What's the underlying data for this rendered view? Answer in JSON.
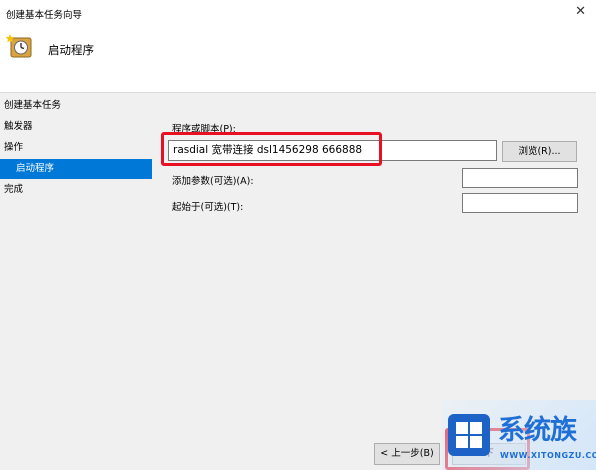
{
  "window": {
    "title": "创建基本任务向导",
    "close_glyph": "✕"
  },
  "header": {
    "title": "启动程序",
    "icon": "task-clock-icon"
  },
  "nav": {
    "items": [
      {
        "label": "创建基本任务",
        "selected": false
      },
      {
        "label": "触发器",
        "selected": false
      },
      {
        "label": "操作",
        "selected": false
      },
      {
        "label": "启动程序",
        "selected": true
      },
      {
        "label": "完成",
        "selected": false
      }
    ]
  },
  "form": {
    "program_label": "程序或脚本(P):",
    "program_value": "rasdial 宽带连接 dsl1456298 666888",
    "browse_label": "浏览(R)...",
    "args_label": "添加参数(可选)(A):",
    "args_value": "",
    "startin_label": "起始于(可选)(T):",
    "startin_value": ""
  },
  "footer": {
    "back_label": "< 上一步(B)",
    "next_label": "下"
  },
  "watermark": {
    "text": "系统族",
    "url": "WWW.XITONGZU.COM"
  },
  "colors": {
    "highlight": "#e81123",
    "selection": "#0078d7",
    "watermark": "#1f6fd6"
  }
}
